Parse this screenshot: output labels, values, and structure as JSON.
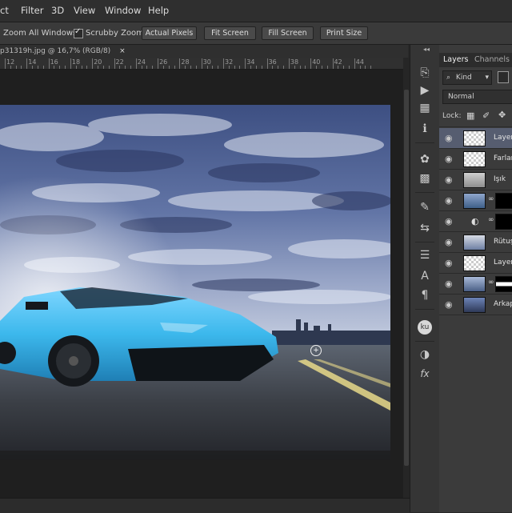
{
  "menu": [
    "ct",
    "Filter",
    "3D",
    "View",
    "Window",
    "Help"
  ],
  "options": {
    "zoom_all": "Zoom All Windows",
    "scrubby": "Scrubby Zoom",
    "buttons": [
      "Actual Pixels",
      "Fit Screen",
      "Fill Screen",
      "Print Size"
    ]
  },
  "document": {
    "tab_title": "p31319h.jpg @ 16,7% (RGB/8)",
    "close": "×"
  },
  "ruler_ticks": [
    "12",
    "14",
    "16",
    "18",
    "20",
    "22",
    "24",
    "26",
    "28",
    "30",
    "32",
    "34",
    "36",
    "38",
    "40",
    "42",
    "44"
  ],
  "panel": {
    "collapse": "◂◂",
    "tabs": [
      "Layers",
      "Channels"
    ],
    "filter_kind": "Kind",
    "blend_mode": "Normal",
    "lock_label": "Lock:",
    "layers": [
      {
        "name": "Layer",
        "selected": true
      },
      {
        "name": "Farlar"
      },
      {
        "name": "Işık"
      },
      {
        "name": ""
      },
      {
        "name": ""
      },
      {
        "name": "Rütuş"
      },
      {
        "name": "Layer"
      },
      {
        "name": ""
      },
      {
        "name": "Arkap"
      }
    ]
  },
  "colors": {
    "accent": "#4a9fd8",
    "selected_layer": "#565d70",
    "car": "#3cb8ec"
  }
}
